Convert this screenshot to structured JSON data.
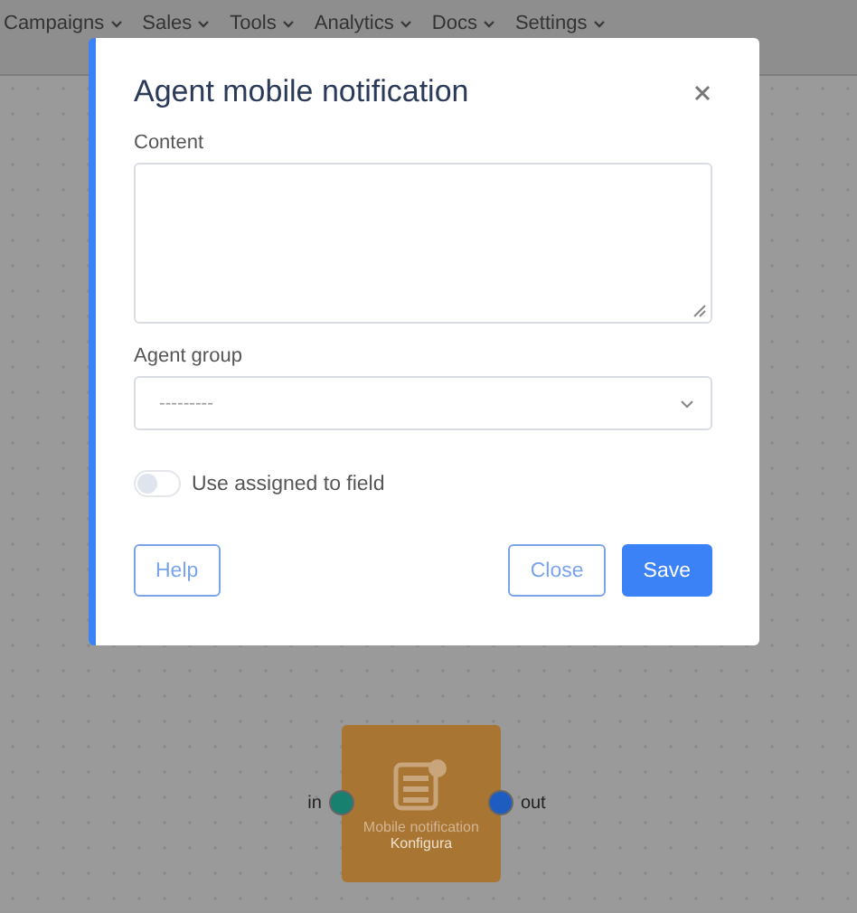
{
  "nav": {
    "items": [
      {
        "label": "Campaigns"
      },
      {
        "label": "Sales"
      },
      {
        "label": "Tools"
      },
      {
        "label": "Analytics"
      },
      {
        "label": "Docs"
      },
      {
        "label": "Settings"
      }
    ]
  },
  "node": {
    "title": "Mobile notification",
    "subtitle": "Konfigura",
    "ports": [
      {
        "label": "in",
        "color": "#17806f"
      },
      {
        "label": "out",
        "color": "#1d5cc0"
      }
    ]
  },
  "modal": {
    "title": "Agent mobile notification",
    "fields": [
      {
        "kind": "textarea",
        "label": "Content"
      },
      {
        "kind": "select",
        "label": "Agent group",
        "placeholder": "---------"
      },
      {
        "kind": "toggle",
        "label": "Use assigned to field",
        "on": false
      }
    ],
    "footer": {
      "left": [
        {
          "label": "Help",
          "kind": "outline"
        }
      ],
      "right": [
        {
          "label": "Close",
          "kind": "outline"
        },
        {
          "label": "Save",
          "kind": "primary"
        }
      ]
    }
  }
}
